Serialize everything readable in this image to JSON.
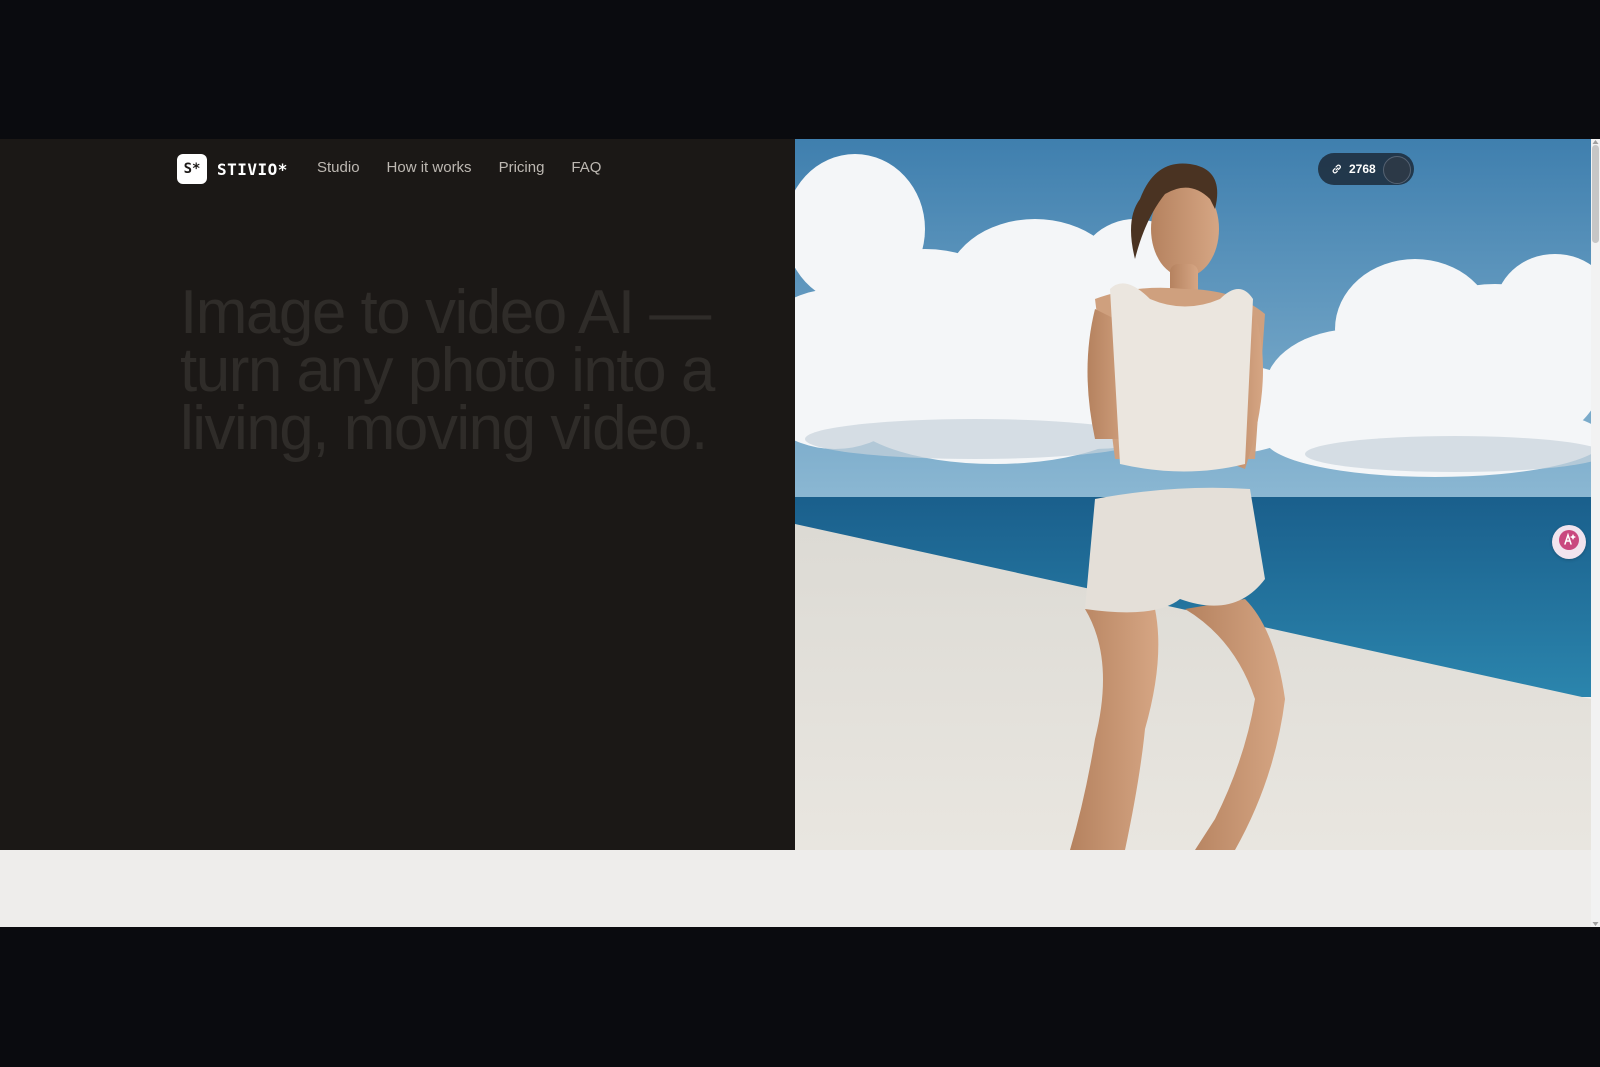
{
  "brand": {
    "mark": "S*",
    "name": "STIVIO*"
  },
  "nav": {
    "items": [
      "Studio",
      "How it works",
      "Pricing",
      "FAQ"
    ]
  },
  "hero": {
    "headline_lines": [
      "Image to video AI —",
      "turn any photo into a",
      "living, moving video."
    ]
  },
  "counter": {
    "value": "2768",
    "icon": "link-icon"
  },
  "widget": {
    "icon": "sparkle-translate-icon"
  },
  "colors": {
    "page_background": "#0a0b0f",
    "hero_left_bg": "#1b1816",
    "headline_text": "#2f2c29",
    "nav_text": "#bdb8b2",
    "below_hero_bg": "#eeedeb"
  }
}
